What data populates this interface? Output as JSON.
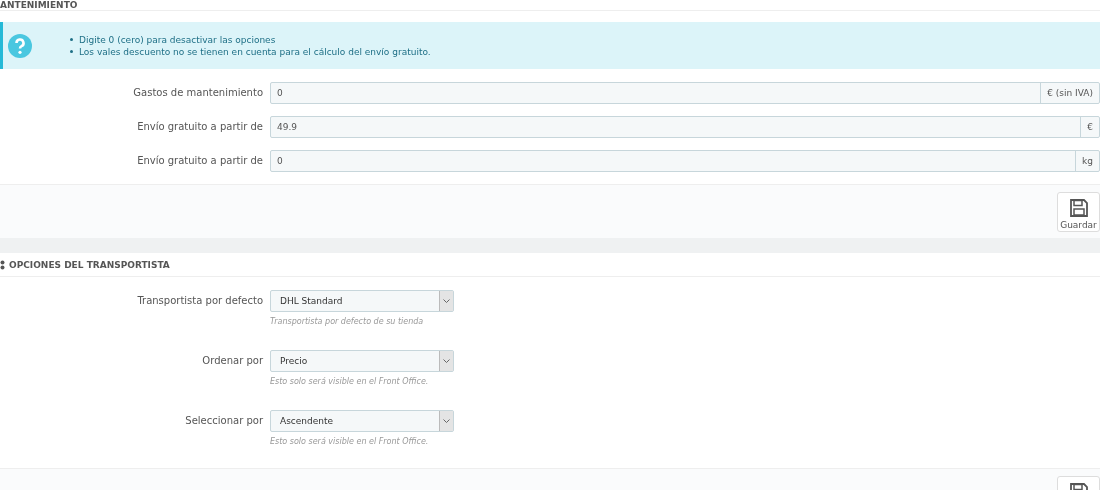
{
  "panels": [
    {
      "title": "ANTENIMIENTO",
      "info": [
        "Digite 0 (cero) para desactivar las opciones",
        "Los vales descuento no se tienen en cuenta para el cálculo del envío gratuito."
      ],
      "fields": [
        {
          "kind": "input",
          "label": "Gastos de mantenimiento",
          "value": "0",
          "suffix": "€ (sin IVA)"
        },
        {
          "kind": "input",
          "label": "Envío gratuito a partir de",
          "value": "49.9",
          "suffix": "€"
        },
        {
          "kind": "input",
          "label": "Envío gratuito a partir de",
          "value": "0",
          "suffix": "kg"
        }
      ],
      "save": "Guardar"
    },
    {
      "title": "OPCIONES DEL TRANSPORTISTA",
      "fields": [
        {
          "kind": "select",
          "label": "Transportista por defecto",
          "value": "DHL Standard",
          "help": "Transportista por defecto de su tienda"
        },
        {
          "kind": "select",
          "label": "Ordenar por",
          "value": "Precio",
          "help": "Esto solo será visible en el Front Office."
        },
        {
          "kind": "select",
          "label": "Seleccionar por",
          "value": "Ascendente",
          "help": "Esto solo será visible en el Front Office."
        }
      ]
    }
  ]
}
